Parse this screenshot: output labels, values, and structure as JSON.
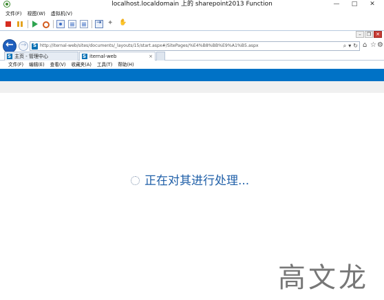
{
  "vm_window": {
    "title": "localhost.localdomain 上的 sharepoint2013 Function",
    "controls": {
      "minimize": "—",
      "maximize": "□",
      "close": "✕"
    },
    "menus": [
      "文件(F)",
      "视图(W)",
      "虚拟机(V)"
    ],
    "toolbar_icons": [
      "stop-icon",
      "pause-icon",
      "play-icon",
      "reset-icon",
      "snapshot-icon",
      "revert-icon",
      "snapshot-manager-icon",
      "send-keys-icon",
      "settings-icon",
      "usb-icon"
    ]
  },
  "browser": {
    "controls": {
      "minimize": "–",
      "maximize": "❐",
      "close": "✕"
    },
    "url": "http://iternal-web/sites/documents/_layouts/15/start.aspx#/SitePages/%E4%B8%BB%E9%A1%B5.aspx",
    "address_tools": [
      "⌕",
      "▾",
      "↻"
    ],
    "command_icons": {
      "home": "⌂",
      "favorites": "☆",
      "tools": "⚙"
    },
    "tabs": [
      {
        "label": "主页 - 管理中心",
        "active": false
      },
      {
        "label": "iternal-web",
        "active": true
      }
    ],
    "tab_close": "×",
    "menus": [
      "文件(F)",
      "编辑(E)",
      "查看(V)",
      "收藏夹(A)",
      "工具(T)",
      "帮助(H)"
    ]
  },
  "sharepoint": {
    "suite_bar_color": "#0072c6",
    "status_text": "正在对其进行处理..."
  },
  "watermark": "高文龙"
}
